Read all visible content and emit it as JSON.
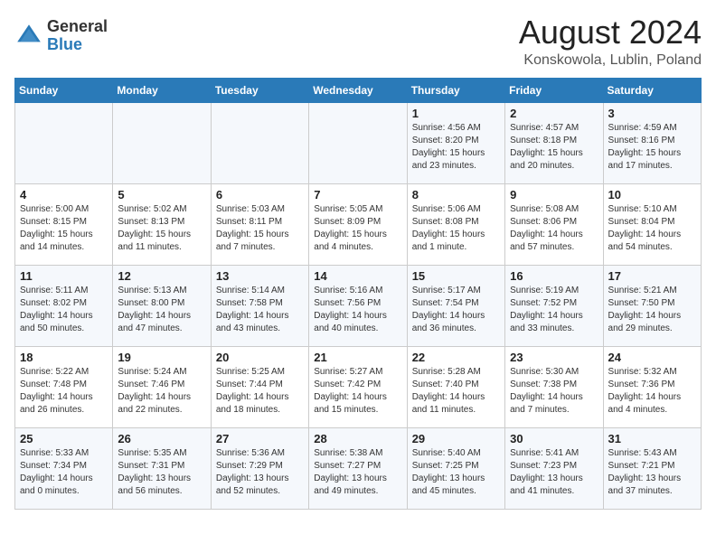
{
  "header": {
    "logo_general": "General",
    "logo_blue": "Blue",
    "month_title": "August 2024",
    "location": "Konskowola, Lublin, Poland"
  },
  "days_of_week": [
    "Sunday",
    "Monday",
    "Tuesday",
    "Wednesday",
    "Thursday",
    "Friday",
    "Saturday"
  ],
  "weeks": [
    [
      {
        "day": "",
        "info": ""
      },
      {
        "day": "",
        "info": ""
      },
      {
        "day": "",
        "info": ""
      },
      {
        "day": "",
        "info": ""
      },
      {
        "day": "1",
        "info": "Sunrise: 4:56 AM\nSunset: 8:20 PM\nDaylight: 15 hours\nand 23 minutes."
      },
      {
        "day": "2",
        "info": "Sunrise: 4:57 AM\nSunset: 8:18 PM\nDaylight: 15 hours\nand 20 minutes."
      },
      {
        "day": "3",
        "info": "Sunrise: 4:59 AM\nSunset: 8:16 PM\nDaylight: 15 hours\nand 17 minutes."
      }
    ],
    [
      {
        "day": "4",
        "info": "Sunrise: 5:00 AM\nSunset: 8:15 PM\nDaylight: 15 hours\nand 14 minutes."
      },
      {
        "day": "5",
        "info": "Sunrise: 5:02 AM\nSunset: 8:13 PM\nDaylight: 15 hours\nand 11 minutes."
      },
      {
        "day": "6",
        "info": "Sunrise: 5:03 AM\nSunset: 8:11 PM\nDaylight: 15 hours\nand 7 minutes."
      },
      {
        "day": "7",
        "info": "Sunrise: 5:05 AM\nSunset: 8:09 PM\nDaylight: 15 hours\nand 4 minutes."
      },
      {
        "day": "8",
        "info": "Sunrise: 5:06 AM\nSunset: 8:08 PM\nDaylight: 15 hours\nand 1 minute."
      },
      {
        "day": "9",
        "info": "Sunrise: 5:08 AM\nSunset: 8:06 PM\nDaylight: 14 hours\nand 57 minutes."
      },
      {
        "day": "10",
        "info": "Sunrise: 5:10 AM\nSunset: 8:04 PM\nDaylight: 14 hours\nand 54 minutes."
      }
    ],
    [
      {
        "day": "11",
        "info": "Sunrise: 5:11 AM\nSunset: 8:02 PM\nDaylight: 14 hours\nand 50 minutes."
      },
      {
        "day": "12",
        "info": "Sunrise: 5:13 AM\nSunset: 8:00 PM\nDaylight: 14 hours\nand 47 minutes."
      },
      {
        "day": "13",
        "info": "Sunrise: 5:14 AM\nSunset: 7:58 PM\nDaylight: 14 hours\nand 43 minutes."
      },
      {
        "day": "14",
        "info": "Sunrise: 5:16 AM\nSunset: 7:56 PM\nDaylight: 14 hours\nand 40 minutes."
      },
      {
        "day": "15",
        "info": "Sunrise: 5:17 AM\nSunset: 7:54 PM\nDaylight: 14 hours\nand 36 minutes."
      },
      {
        "day": "16",
        "info": "Sunrise: 5:19 AM\nSunset: 7:52 PM\nDaylight: 14 hours\nand 33 minutes."
      },
      {
        "day": "17",
        "info": "Sunrise: 5:21 AM\nSunset: 7:50 PM\nDaylight: 14 hours\nand 29 minutes."
      }
    ],
    [
      {
        "day": "18",
        "info": "Sunrise: 5:22 AM\nSunset: 7:48 PM\nDaylight: 14 hours\nand 26 minutes."
      },
      {
        "day": "19",
        "info": "Sunrise: 5:24 AM\nSunset: 7:46 PM\nDaylight: 14 hours\nand 22 minutes."
      },
      {
        "day": "20",
        "info": "Sunrise: 5:25 AM\nSunset: 7:44 PM\nDaylight: 14 hours\nand 18 minutes."
      },
      {
        "day": "21",
        "info": "Sunrise: 5:27 AM\nSunset: 7:42 PM\nDaylight: 14 hours\nand 15 minutes."
      },
      {
        "day": "22",
        "info": "Sunrise: 5:28 AM\nSunset: 7:40 PM\nDaylight: 14 hours\nand 11 minutes."
      },
      {
        "day": "23",
        "info": "Sunrise: 5:30 AM\nSunset: 7:38 PM\nDaylight: 14 hours\nand 7 minutes."
      },
      {
        "day": "24",
        "info": "Sunrise: 5:32 AM\nSunset: 7:36 PM\nDaylight: 14 hours\nand 4 minutes."
      }
    ],
    [
      {
        "day": "25",
        "info": "Sunrise: 5:33 AM\nSunset: 7:34 PM\nDaylight: 14 hours\nand 0 minutes."
      },
      {
        "day": "26",
        "info": "Sunrise: 5:35 AM\nSunset: 7:31 PM\nDaylight: 13 hours\nand 56 minutes."
      },
      {
        "day": "27",
        "info": "Sunrise: 5:36 AM\nSunset: 7:29 PM\nDaylight: 13 hours\nand 52 minutes."
      },
      {
        "day": "28",
        "info": "Sunrise: 5:38 AM\nSunset: 7:27 PM\nDaylight: 13 hours\nand 49 minutes."
      },
      {
        "day": "29",
        "info": "Sunrise: 5:40 AM\nSunset: 7:25 PM\nDaylight: 13 hours\nand 45 minutes."
      },
      {
        "day": "30",
        "info": "Sunrise: 5:41 AM\nSunset: 7:23 PM\nDaylight: 13 hours\nand 41 minutes."
      },
      {
        "day": "31",
        "info": "Sunrise: 5:43 AM\nSunset: 7:21 PM\nDaylight: 13 hours\nand 37 minutes."
      }
    ]
  ]
}
